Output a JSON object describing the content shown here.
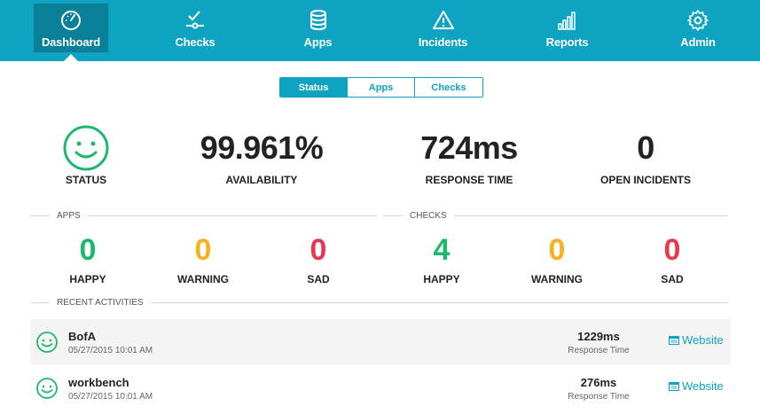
{
  "nav": {
    "items": [
      {
        "label": "Dashboard",
        "icon": "gauge-icon"
      },
      {
        "label": "Checks",
        "icon": "checks-icon"
      },
      {
        "label": "Apps",
        "icon": "database-icon"
      },
      {
        "label": "Incidents",
        "icon": "warning-icon"
      },
      {
        "label": "Reports",
        "icon": "bar-chart-icon"
      },
      {
        "label": "Admin",
        "icon": "gear-icon"
      }
    ],
    "active": "Dashboard"
  },
  "tabs": {
    "items": [
      "Status",
      "Apps",
      "Checks"
    ],
    "active": "Status"
  },
  "summary": {
    "status_label": "STATUS",
    "availability_value": "99.961%",
    "availability_label": "AVAILABILITY",
    "response_value": "724ms",
    "response_label": "RESPONSE TIME",
    "incidents_value": "0",
    "incidents_label": "OPEN INCIDENTS"
  },
  "apps": {
    "header": "APPS",
    "happy": "0",
    "happy_label": "HAPPY",
    "warning": "0",
    "warning_label": "WARNING",
    "sad": "0",
    "sad_label": "SAD"
  },
  "checks": {
    "header": "CHECKS",
    "happy": "4",
    "happy_label": "HAPPY",
    "warning": "0",
    "warning_label": "WARNING",
    "sad": "0",
    "sad_label": "SAD"
  },
  "recent": {
    "header": "RECENT ACTIVITIES",
    "items": [
      {
        "name": "BofA",
        "time": "05/27/2015 10:01 AM",
        "response": "1229ms",
        "response_label": "Response Time",
        "link": "Website"
      },
      {
        "name": "workbench",
        "time": "05/27/2015 10:01 AM",
        "response": "276ms",
        "response_label": "Response Time",
        "link": "Website"
      }
    ]
  },
  "colors": {
    "accent": "#0fa3c2",
    "accent_dark": "#0a7f98",
    "happy": "#1db76e",
    "warning": "#f6b11c",
    "sad": "#e8384f"
  }
}
